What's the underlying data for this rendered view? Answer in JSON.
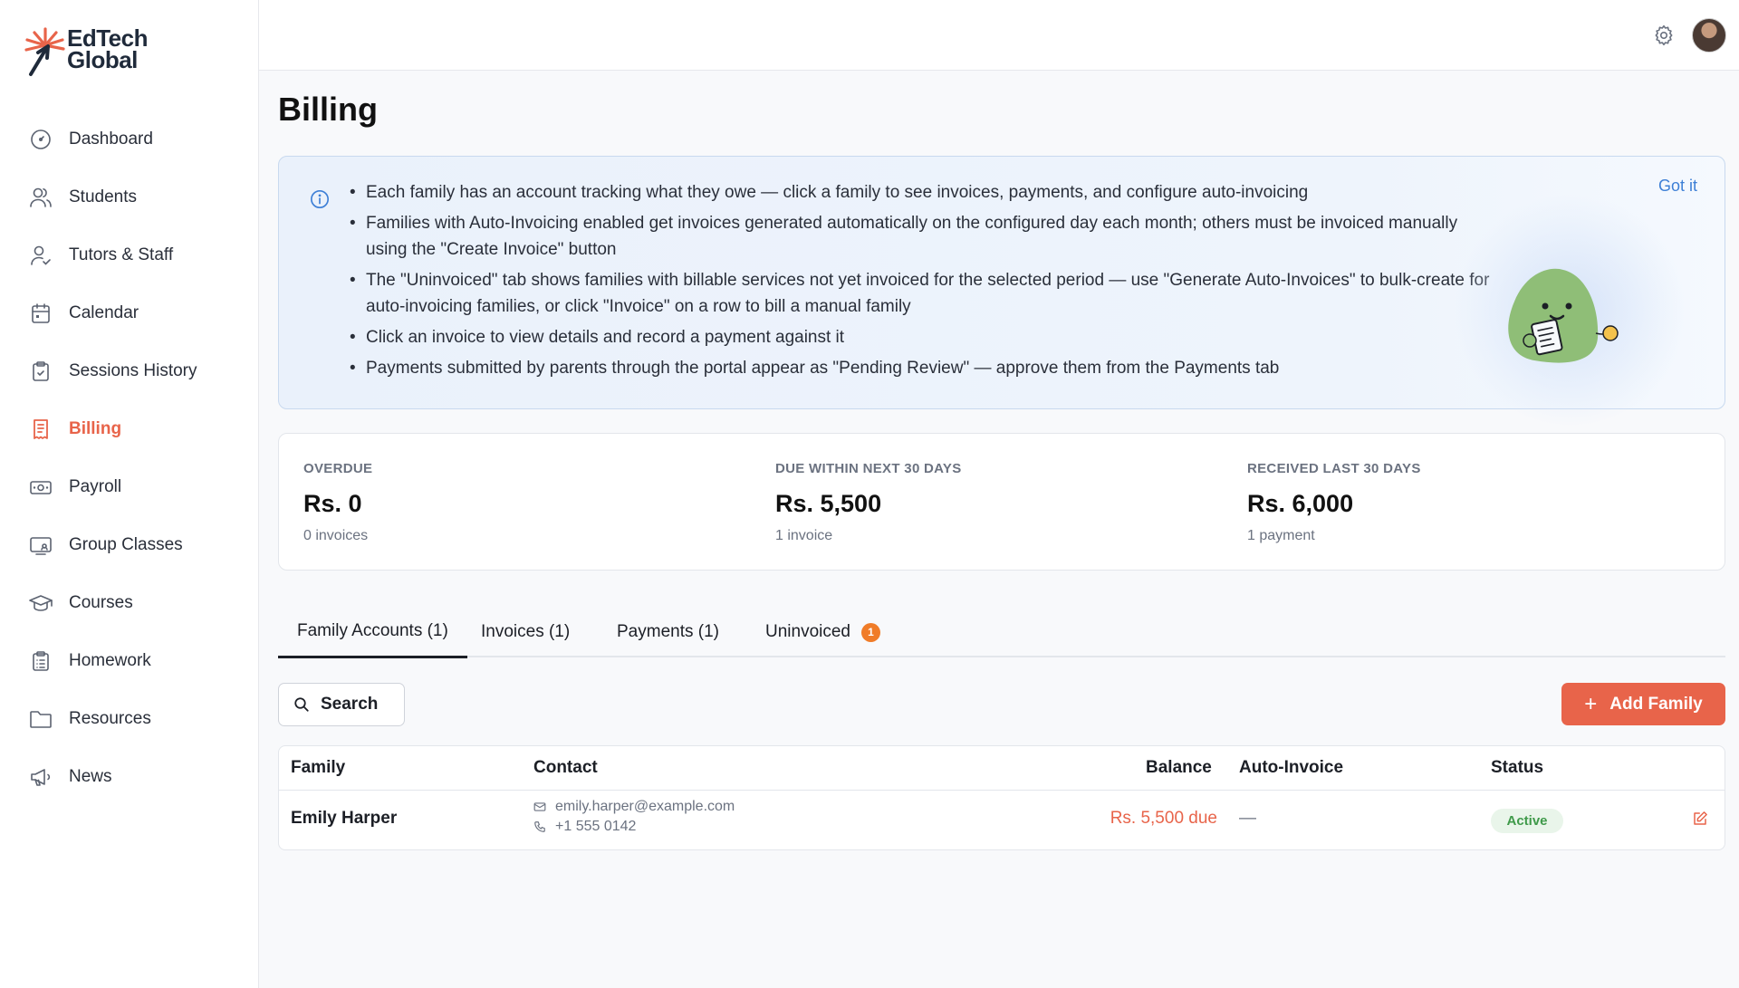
{
  "brand": {
    "line1": "EdTech",
    "line2": "Global",
    "accent": "#e8644a"
  },
  "sidebar": {
    "items": [
      {
        "label": "Dashboard",
        "icon": "dashboard-icon",
        "active": false
      },
      {
        "label": "Students",
        "icon": "users-icon",
        "active": false
      },
      {
        "label": "Tutors & Staff",
        "icon": "user-check-icon",
        "active": false
      },
      {
        "label": "Calendar",
        "icon": "calendar-icon",
        "active": false
      },
      {
        "label": "Sessions History",
        "icon": "clipboard-check-icon",
        "active": false
      },
      {
        "label": "Billing",
        "icon": "receipt-icon",
        "active": true
      },
      {
        "label": "Payroll",
        "icon": "banknote-icon",
        "active": false
      },
      {
        "label": "Group Classes",
        "icon": "screen-icon",
        "active": false
      },
      {
        "label": "Courses",
        "icon": "graduation-cap-icon",
        "active": false
      },
      {
        "label": "Homework",
        "icon": "clipboard-list-icon",
        "active": false
      },
      {
        "label": "Resources",
        "icon": "folder-icon",
        "active": false
      },
      {
        "label": "News",
        "icon": "megaphone-icon",
        "active": false
      }
    ]
  },
  "page": {
    "title": "Billing"
  },
  "info": {
    "got_it": "Got it",
    "bullets": [
      "Each family has an account tracking what they owe — click a family to see invoices, payments, and configure auto-invoicing",
      "Families with Auto-Invoicing enabled get invoices generated automatically on the configured day each month; others must be invoiced manually using the \"Create Invoice\" button",
      "The \"Uninvoiced\" tab shows families with billable services not yet invoiced for the selected period — use \"Generate Auto-Invoices\" to bulk-create for auto-invoicing families, or click \"Invoice\" on a row to bill a manual family",
      "Click an invoice to view details and record a payment against it",
      "Payments submitted by parents through the portal appear as \"Pending Review\" — approve them from the Payments tab"
    ]
  },
  "stats": [
    {
      "label": "OVERDUE",
      "value": "Rs. 0",
      "sub": "0 invoices"
    },
    {
      "label": "DUE WITHIN NEXT 30 DAYS",
      "value": "Rs. 5,500",
      "sub": "1 invoice"
    },
    {
      "label": "RECEIVED LAST 30 DAYS",
      "value": "Rs. 6,000",
      "sub": "1 payment"
    }
  ],
  "tabs": [
    {
      "label": "Family Accounts (1)",
      "active": true
    },
    {
      "label": "Invoices (1)",
      "active": false
    },
    {
      "label": "Payments (1)",
      "active": false
    },
    {
      "label": "Uninvoiced",
      "active": false,
      "badge": "1"
    }
  ],
  "toolbar": {
    "search_label": "Search",
    "add_label": "Add Family"
  },
  "table": {
    "headers": {
      "family": "Family",
      "contact": "Contact",
      "balance": "Balance",
      "auto_invoice": "Auto-Invoice",
      "status": "Status"
    },
    "rows": [
      {
        "family": "Emily Harper",
        "email": "emily.harper@example.com",
        "phone": "+1 555 0142",
        "balance": "Rs. 5,500 due",
        "auto_invoice": "—",
        "status": "Active"
      }
    ]
  }
}
